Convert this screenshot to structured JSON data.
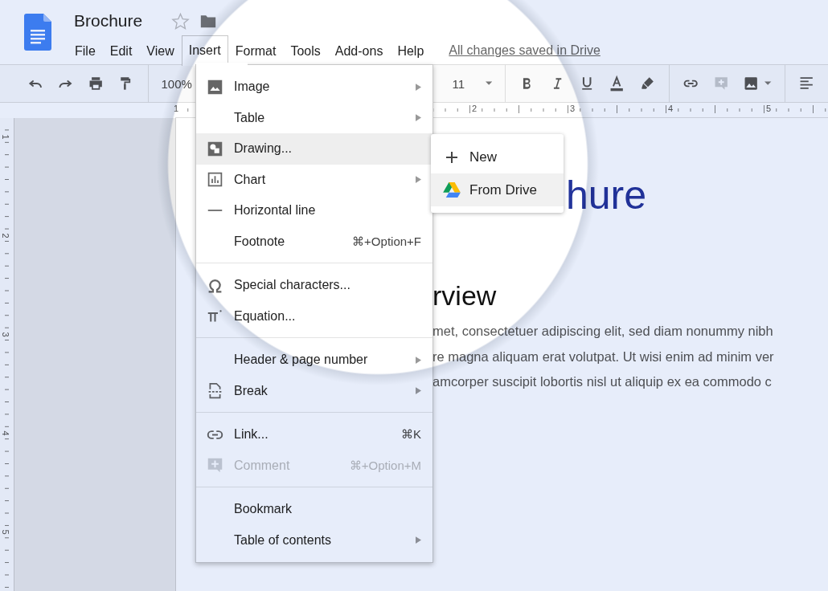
{
  "doc": {
    "title": "Brochure",
    "save_status": "All changes saved in Drive"
  },
  "menu_bar": [
    {
      "label": "File",
      "selected": false
    },
    {
      "label": "Edit",
      "selected": false
    },
    {
      "label": "View",
      "selected": false
    },
    {
      "label": "Insert",
      "selected": true
    },
    {
      "label": "Format",
      "selected": false
    },
    {
      "label": "Tools",
      "selected": false
    },
    {
      "label": "Add-ons",
      "selected": false
    },
    {
      "label": "Help",
      "selected": false
    }
  ],
  "toolbar": {
    "zoom": "100%",
    "font_size": "11"
  },
  "ruler": {
    "horizontal": [
      "1",
      "2",
      "3",
      "4",
      "5"
    ],
    "vertical": [
      "1",
      "2",
      "3",
      "4",
      "5"
    ]
  },
  "page": {
    "title_fragment": "hure",
    "heading_fragment": "rview",
    "body_lines": [
      "met, consectetuer adipiscing elit, sed diam nonummy nibh",
      "re magna aliquam erat volutpat. Ut wisi enim ad minim ver",
      "amcorper suscipit lobortis nisl ut aliquip ex ea commodo c"
    ]
  },
  "insert_menu": {
    "sections": [
      {
        "items": [
          {
            "label": "Image",
            "submenu": true,
            "disabled": false,
            "selected": false
          },
          {
            "label": "Table",
            "submenu": true,
            "disabled": false,
            "selected": false
          },
          {
            "label": "Drawing...",
            "submenu": false,
            "disabled": false,
            "selected": true
          },
          {
            "label": "Chart",
            "submenu": true,
            "disabled": false,
            "selected": false
          },
          {
            "label": "Horizontal line",
            "submenu": false,
            "disabled": false,
            "selected": false
          },
          {
            "label": "Footnote",
            "shortcut": "⌘+Option+F",
            "submenu": false,
            "disabled": false,
            "selected": false
          }
        ]
      },
      {
        "items": [
          {
            "label": "Special characters...",
            "submenu": false,
            "disabled": false,
            "selected": false
          },
          {
            "label": "Equation...",
            "submenu": false,
            "disabled": false,
            "selected": false
          }
        ]
      },
      {
        "items": [
          {
            "label": "Header & page number",
            "submenu": true,
            "disabled": false,
            "selected": false
          },
          {
            "label": "Break",
            "submenu": true,
            "disabled": false,
            "selected": false
          }
        ]
      },
      {
        "items": [
          {
            "label": "Link...",
            "shortcut": "⌘K",
            "submenu": false,
            "disabled": false,
            "selected": false
          },
          {
            "label": "Comment",
            "shortcut": "⌘+Option+M",
            "submenu": false,
            "disabled": true,
            "selected": false
          }
        ]
      },
      {
        "items": [
          {
            "label": "Bookmark",
            "submenu": false,
            "disabled": false,
            "selected": false
          },
          {
            "label": "Table of contents",
            "submenu": true,
            "disabled": false,
            "selected": false
          }
        ]
      }
    ]
  },
  "drawing_submenu": {
    "items": [
      {
        "label": "New",
        "selected": false
      },
      {
        "label": "From Drive",
        "selected": true
      }
    ]
  }
}
